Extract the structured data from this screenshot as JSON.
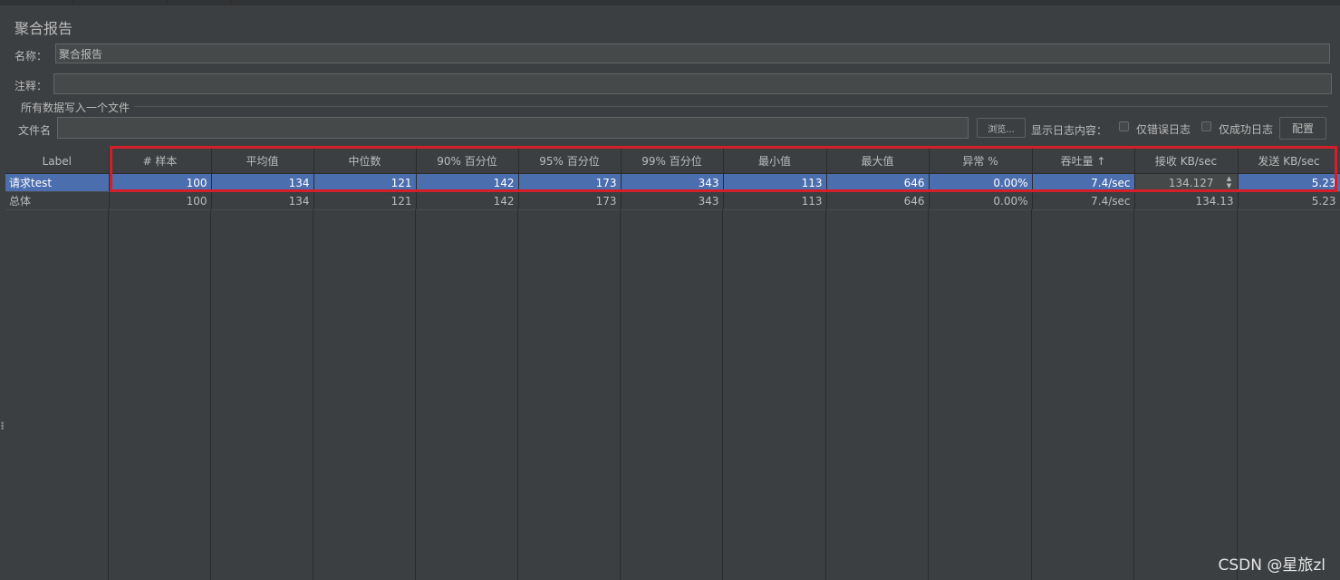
{
  "panel": {
    "title": "聚合报告",
    "name_label": "名称：",
    "name_value": "聚合报告",
    "comment_label": "注释：",
    "comment_value": "",
    "group_title": "所有数据写入一个文件",
    "filename_label": "文件名",
    "filename_value": "",
    "browse_label": "浏览...",
    "log_content_label": "显示日志内容：",
    "errors_only_label": "仅错误日志",
    "success_only_label": "仅成功日志",
    "configure_label": "配置"
  },
  "table": {
    "headers": [
      "Label",
      "# 样本",
      "平均值",
      "中位数",
      "90% 百分位",
      "95% 百分位",
      "99% 百分位",
      "最小值",
      "最大值",
      "异常 %",
      "吞吐量 ↑",
      "接收 KB/sec",
      "发送 KB/sec"
    ],
    "rows": [
      [
        "请求test",
        "100",
        "134",
        "121",
        "142",
        "173",
        "343",
        "113",
        "646",
        "0.00%",
        "7.4/sec",
        "134.127",
        "5.23"
      ],
      [
        "总体",
        "100",
        "134",
        "121",
        "142",
        "173",
        "343",
        "113",
        "646",
        "0.00%",
        "7.4/sec",
        "134.13",
        "5.23"
      ]
    ],
    "selected_row": 0,
    "editing_column": 11
  },
  "watermark": "CSDN @星旅zl",
  "colors": {
    "background": "#3c3f41",
    "selection": "#4b6eaf",
    "highlight_box": "#d51f28",
    "text": "#bbbbbb"
  }
}
